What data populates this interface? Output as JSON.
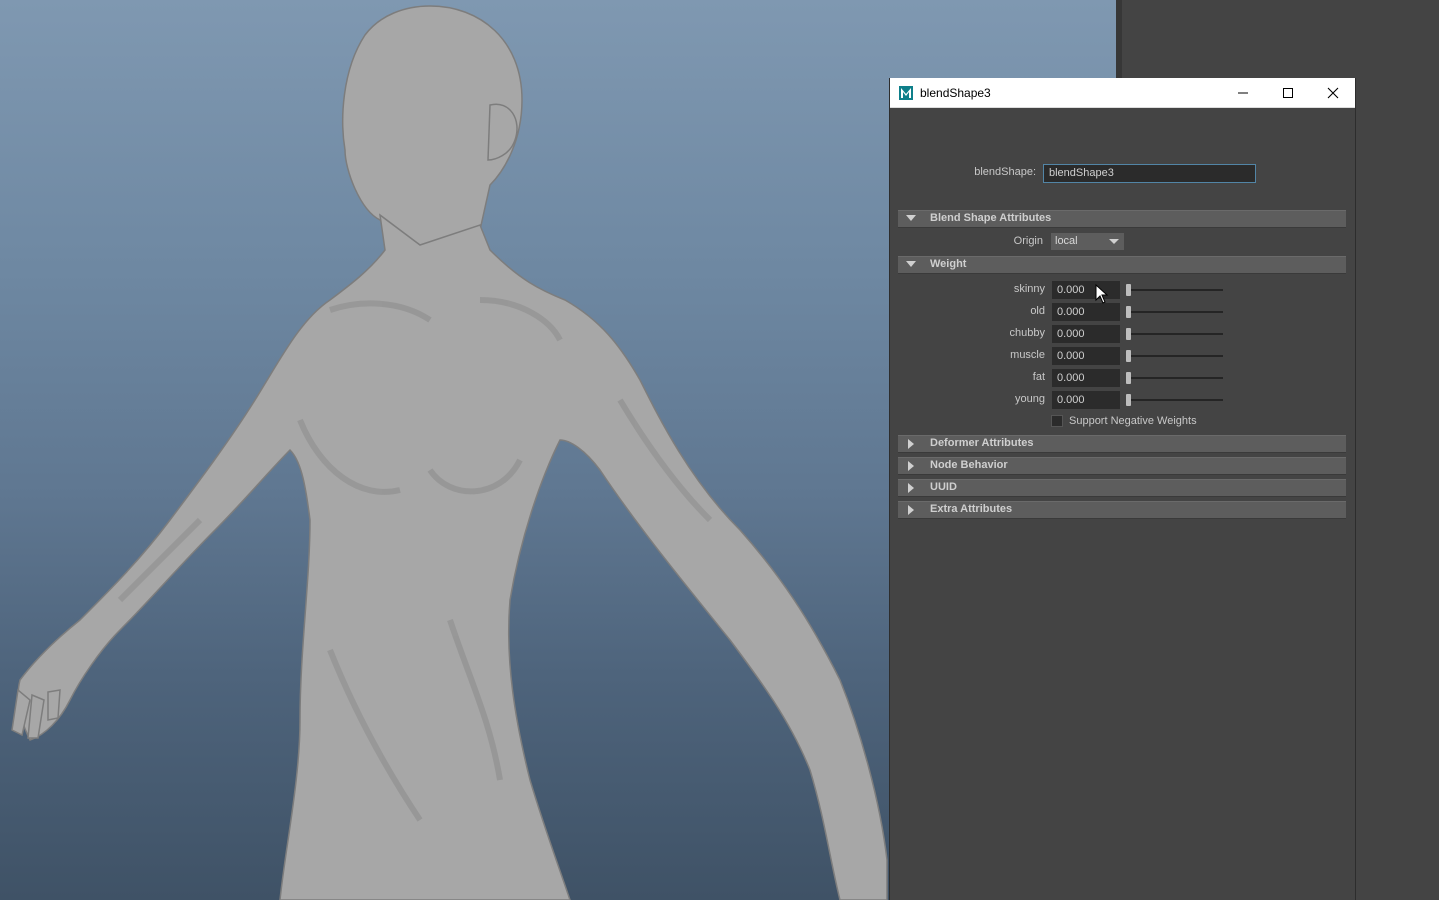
{
  "window": {
    "title": "blendShape3",
    "app_icon": "maya-icon",
    "controls": [
      "minimize-icon",
      "maximize-icon",
      "close-icon"
    ]
  },
  "node": {
    "label": "blendShape:",
    "value": "blendShape3"
  },
  "sections": {
    "blend_shape_attributes": "Blend Shape Attributes",
    "weight": "Weight",
    "deformer_attributes": "Deformer Attributes",
    "node_behavior": "Node Behavior",
    "uuid": "UUID",
    "extra_attributes": "Extra Attributes"
  },
  "origin": {
    "label": "Origin",
    "value": "local"
  },
  "weights": [
    {
      "label": "skinny",
      "value": "0.000",
      "level": 0
    },
    {
      "label": "old",
      "value": "0.000",
      "level": 0
    },
    {
      "label": "chubby",
      "value": "0.000",
      "level": 0
    },
    {
      "label": "muscle",
      "value": "0.000",
      "level": 0
    },
    {
      "label": "fat",
      "value": "0.000",
      "level": 0
    },
    {
      "label": "young",
      "value": "0.000",
      "level": 0
    }
  ],
  "support_negative_weights": {
    "label": "Support Negative Weights",
    "checked": false
  },
  "colors": {
    "viewport_top": "#7f98b1",
    "viewport_bottom": "#3f5266",
    "panel_bg": "#444444",
    "section_header": "#5d5d5d",
    "field_bg": "#2b2b2b",
    "focus_border": "#5285a6"
  }
}
